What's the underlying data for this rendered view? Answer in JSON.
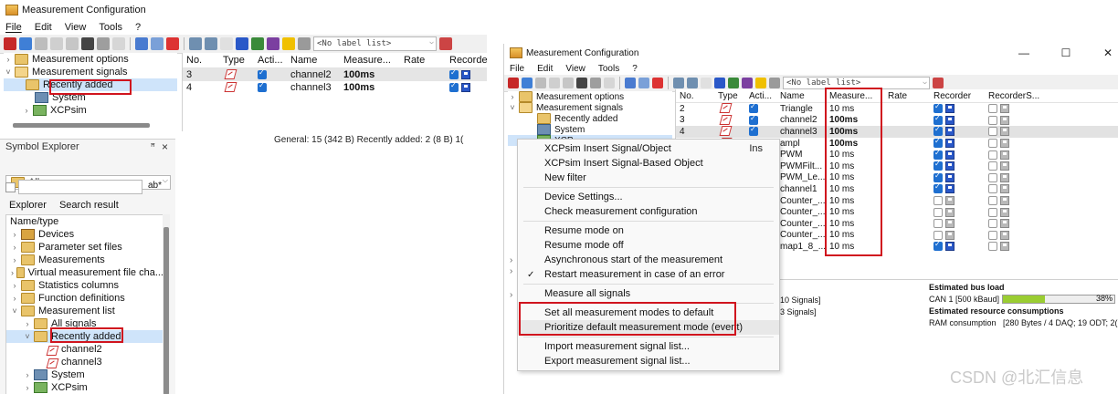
{
  "left": {
    "title": "Measurement Configuration",
    "menu": [
      "File",
      "Edit",
      "View",
      "Tools",
      "?"
    ],
    "label_combo": "<No label list>",
    "tree": [
      {
        "label": "Measurement options",
        "expander": "›"
      },
      {
        "label": "Measurement signals",
        "expander": "˅"
      },
      {
        "label": "Recently added",
        "expander": ""
      },
      {
        "label": "System",
        "expander": ""
      },
      {
        "label": "XCPsim",
        "expander": "›"
      }
    ],
    "grid_headers": [
      "No.",
      "Type",
      "Acti...",
      "Name",
      "Measure...",
      "Rate",
      "Recorder"
    ],
    "grid_rows": [
      {
        "no": "3",
        "name": "channel2",
        "measure": "100ms"
      },
      {
        "no": "4",
        "name": "channel3",
        "measure": "100ms"
      }
    ],
    "status": "General:  15 (342 B)    Recently added: 2 (8 B)    1(",
    "symbol_explorer": {
      "title": "Symbol Explorer",
      "pin": "ꟸ",
      "close": "×",
      "filter_value": "All",
      "search_btn": "ab*",
      "tabs": [
        "Explorer",
        "Search result"
      ],
      "column_header": "Name/type",
      "items": [
        {
          "label": "Devices",
          "expander": "›",
          "indent": 0
        },
        {
          "label": "Parameter set files",
          "expander": "›",
          "indent": 0
        },
        {
          "label": "Measurements",
          "expander": "›",
          "indent": 0
        },
        {
          "label": "Virtual measurement file cha...",
          "expander": "›",
          "indent": 0
        },
        {
          "label": "Statistics columns",
          "expander": "›",
          "indent": 0
        },
        {
          "label": "Function definitions",
          "expander": "›",
          "indent": 0
        },
        {
          "label": "Measurement list",
          "expander": "˅",
          "indent": 0
        },
        {
          "label": "All signals",
          "expander": "›",
          "indent": 1
        },
        {
          "label": "Recently added",
          "expander": "˅",
          "indent": 1
        },
        {
          "label": "channel2",
          "expander": "",
          "indent": 2
        },
        {
          "label": "channel3",
          "expander": "",
          "indent": 2
        },
        {
          "label": "System",
          "expander": "›",
          "indent": 1
        },
        {
          "label": "XCPsim",
          "expander": "›",
          "indent": 1
        }
      ]
    }
  },
  "right": {
    "title": "Measurement Configuration",
    "window_buttons": [
      "—",
      "☐",
      "✕"
    ],
    "menu": [
      "File",
      "Edit",
      "View",
      "Tools",
      "?"
    ],
    "label_combo": "<No label list>",
    "tree": [
      {
        "label": "Measurement options",
        "expander": "›"
      },
      {
        "label": "Measurement signals",
        "expander": "˅"
      },
      {
        "label": "Recently added",
        "expander": ""
      },
      {
        "label": "System",
        "expander": ""
      },
      {
        "label": "XCP...",
        "expander": "›"
      }
    ],
    "grid_headers": [
      "No.",
      "Type",
      "Acti...",
      "Name",
      "Measure...",
      "Rate",
      "Recorder",
      "RecorderS..."
    ],
    "grid_rows": [
      {
        "no": "2",
        "name": "Triangle",
        "measure": "10 ms",
        "rec": true,
        "bold": false
      },
      {
        "no": "3",
        "name": "channel2",
        "measure": "100ms",
        "rec": true,
        "bold": true
      },
      {
        "no": "4",
        "name": "channel3",
        "measure": "100ms",
        "rec": true,
        "bold": true
      },
      {
        "no": "",
        "name": "ampl",
        "measure": "100ms",
        "rec": true,
        "bold": true
      },
      {
        "no": "",
        "name": "PWM",
        "measure": "10 ms",
        "rec": true,
        "bold": false
      },
      {
        "no": "",
        "name": "PWMFilt...",
        "measure": "10 ms",
        "rec": true,
        "bold": false
      },
      {
        "no": "",
        "name": "PWM_Le...",
        "measure": "10 ms",
        "rec": true,
        "bold": false
      },
      {
        "no": "",
        "name": "channel1",
        "measure": "10 ms",
        "rec": true,
        "bold": false
      },
      {
        "no": "",
        "name": "Counter_...",
        "measure": "10 ms",
        "rec": false,
        "bold": false
      },
      {
        "no": "",
        "name": "Counter_...",
        "measure": "10 ms",
        "rec": false,
        "bold": false
      },
      {
        "no": "",
        "name": "Counter_...",
        "measure": "10 ms",
        "rec": false,
        "bold": false
      },
      {
        "no": "",
        "name": "Counter_...",
        "measure": "10 ms",
        "rec": false,
        "bold": false
      },
      {
        "no": "",
        "name": "map1_8_...",
        "measure": "10 ms",
        "rec": true,
        "bold": false
      }
    ],
    "context_menu": [
      {
        "label": "XCPsim Insert Signal/Object",
        "shortcut": "Ins",
        "check": false,
        "sep_after": false
      },
      {
        "label": "XCPsim Insert Signal-Based Object",
        "shortcut": "",
        "check": false,
        "sep_after": false
      },
      {
        "label": "New filter",
        "shortcut": "",
        "check": false,
        "sep_after": true
      },
      {
        "label": "Device Settings...",
        "shortcut": "",
        "check": false,
        "sep_after": false
      },
      {
        "label": "Check measurement configuration",
        "shortcut": "",
        "check": false,
        "sep_after": true
      },
      {
        "label": "Resume mode on",
        "shortcut": "",
        "check": false,
        "sep_after": false
      },
      {
        "label": "Resume mode off",
        "shortcut": "",
        "check": false,
        "sep_after": false
      },
      {
        "label": "Asynchronous start of the measurement",
        "shortcut": "",
        "check": false,
        "sep_after": false
      },
      {
        "label": "Restart measurement in case of an error",
        "shortcut": "",
        "check": true,
        "sep_after": true
      },
      {
        "label": "Measure all signals",
        "shortcut": "",
        "check": false,
        "sep_after": true
      },
      {
        "label": "Set all measurement modes to default",
        "shortcut": "",
        "check": false,
        "sep_after": false
      },
      {
        "label": "Prioritize default measurement mode (event)",
        "shortcut": "",
        "check": false,
        "sep_after": true
      },
      {
        "label": "Import measurement signal list...",
        "shortcut": "",
        "check": false,
        "sep_after": false
      },
      {
        "label": "Export measurement signal list...",
        "shortcut": "",
        "check": false,
        "sep_after": false
      }
    ],
    "side_chevrons": [
      "›",
      "›",
      "›"
    ],
    "bottom": {
      "signals1": "10 Signals]",
      "signals2": "3 Signals]",
      "bus_title": "Estimated bus load",
      "bus_line": "CAN 1 [500 kBaud]",
      "bus_percent": "38%",
      "bus_fraction": 0.38,
      "resource_title": "Estimated resource consumptions",
      "ram_label": "RAM consumption",
      "ram_value": "[280 Bytes /  4 DAQ; 19 ODT; 2("
    }
  },
  "watermark": "CSDN @北汇信息",
  "colors": {
    "highlight": "#cfe4fa",
    "redbox": "#d0141e",
    "checkbox": "#1e6fd0",
    "bar": "#9acd32"
  }
}
